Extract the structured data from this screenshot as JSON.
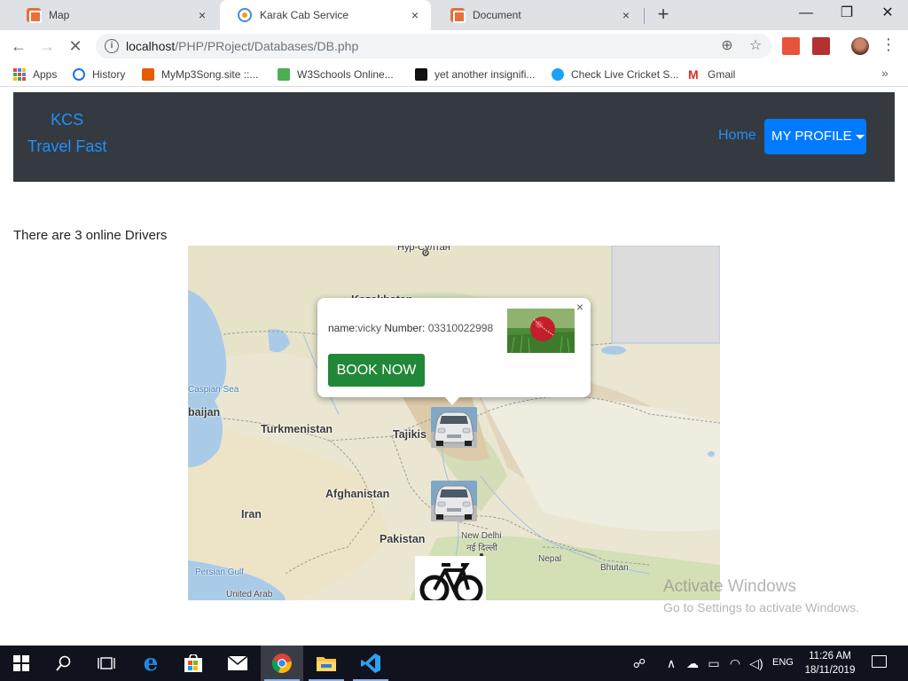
{
  "browser": {
    "tabs": [
      {
        "title": "Map",
        "icon": "xampp-icon"
      },
      {
        "title": "Karak Cab Service",
        "icon": "cab-icon"
      },
      {
        "title": "Document",
        "icon": "xampp-icon"
      }
    ],
    "close_glyph": "×",
    "new_tab_glyph": "+",
    "window_controls": {
      "minimize": "—",
      "maximize": "❐",
      "close": "✕"
    },
    "nav": {
      "back": "←",
      "forward": "→",
      "reload": "✕"
    },
    "url_host": "localhost",
    "url_path": "/PHP/PRoject/Databases/DB.php",
    "menu_glyph": "⋮",
    "bookmarks_more": "»",
    "bookmarks": [
      {
        "label": "Apps"
      },
      {
        "label": "History"
      },
      {
        "label": "MyMp3Song.site ::..."
      },
      {
        "label": "W3Schools Online..."
      },
      {
        "label": "yet another insignifi..."
      },
      {
        "label": "Check Live Cricket S..."
      },
      {
        "label": "Gmail"
      }
    ]
  },
  "navbar": {
    "brand_line1": "KCS",
    "brand_line2": "Travel Fast",
    "home_link": "Home",
    "profile_button": "MY PROFILE"
  },
  "main": {
    "online_drivers_text": "There are 3 online Drivers"
  },
  "map": {
    "labels": {
      "kazakhstan": "Kazakhstan",
      "caspian": "Caspian Sea",
      "azerbaijan": "baijan",
      "turkmenistan": "Turkmenistan",
      "tajikistan": "Tajikis",
      "afghanistan": "Afghanistan",
      "iran": "Iran",
      "pakistan": "Pakistan",
      "new_delhi": "New Delhi",
      "new_delhi_hindi": "नई दिल्ली",
      "nepal": "Nepal",
      "bhutan": "Bhutan",
      "persian_gulf": "Persian Gulf",
      "uae": "United Arab",
      "top_city": "Нур-Султан"
    },
    "popup": {
      "name_label": "name:",
      "name_value": "vicky",
      "number_label": " Number: ",
      "number_value": "03310022998",
      "book_button": "BOOK NOW",
      "close_glyph": "×"
    }
  },
  "watermark": {
    "line1": "Activate Windows",
    "line2": "Go to Settings to activate Windows."
  },
  "taskbar": {
    "language": "ENG",
    "time": "11:26 AM",
    "date": "18/11/2019"
  }
}
